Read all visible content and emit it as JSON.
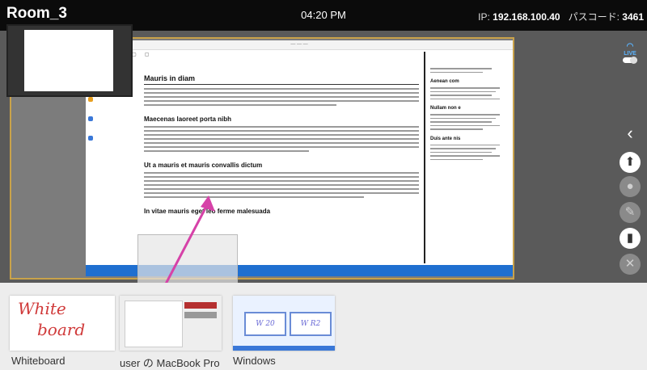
{
  "header": {
    "room": "Room_3",
    "time": "04:20 PM",
    "ip_label": "IP:",
    "ip": "192.168.100.40",
    "passcode_label": "パスコード:",
    "passcode": "3461"
  },
  "document": {
    "heading_1": "Mauris in diam",
    "heading_2": "Maecenas laoreet porta nibh",
    "heading_3": "Ut a mauris et mauris convallis dictum",
    "heading_4": "In vitae mauris eget leo ferme malesuada",
    "side_heading_1": "Aenean com",
    "side_heading_2": "Nullam non e",
    "side_heading_3": "Duis ante nis"
  },
  "rail": {
    "live_label": "LIVE"
  },
  "bottom_tiles": [
    {
      "label": "Whiteboard"
    },
    {
      "label": "user の MacBook Pro"
    },
    {
      "label": "Windows"
    }
  ],
  "whiteboard_text": [
    "White",
    "board"
  ],
  "windows_boxes": [
    "W 20",
    "W R2"
  ],
  "colors": {
    "accent_live": "#5ab4ff",
    "drag_arrow": "#d642a8",
    "topbar": "#0b0b0b"
  }
}
